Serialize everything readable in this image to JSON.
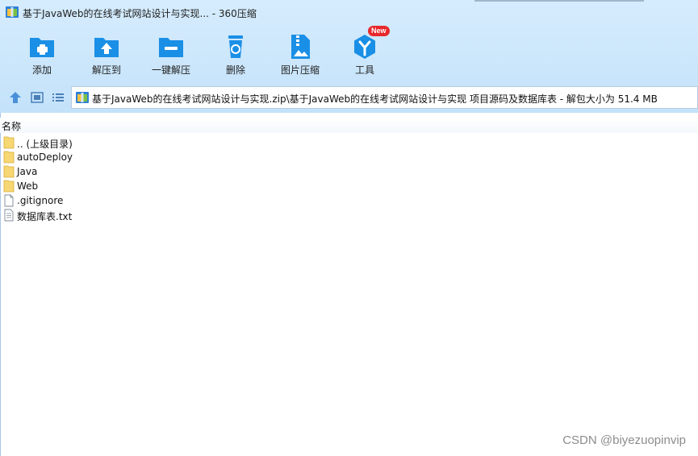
{
  "window": {
    "title": "基于JavaWeb的在线考试网站设计与实现... - 360压缩",
    "title_icon": "archive-icon"
  },
  "toolbar": {
    "items": [
      {
        "label": "添加",
        "icon": "add-folder-icon"
      },
      {
        "label": "解压到",
        "icon": "extract-folder-icon"
      },
      {
        "label": "一键解压",
        "icon": "one-click-extract-icon"
      },
      {
        "label": "删除",
        "icon": "trash-icon"
      },
      {
        "label": "图片压缩",
        "icon": "image-compress-icon"
      },
      {
        "label": "工具",
        "icon": "tools-icon",
        "badge": "New"
      }
    ]
  },
  "navigation": {
    "up_icon": "up-arrow-icon",
    "thumbnail_view_icon": "thumbnail-view-icon",
    "list_view_icon": "list-view-icon",
    "address": "基于JavaWeb的在线考试网站设计与实现.zip\\基于JavaWeb的在线考试网站设计与实现 项目源码及数据库表 - 解包大小为 51.4 MB"
  },
  "file_list": {
    "column_header": "名称",
    "items": [
      {
        "name": ".. (上级目录)",
        "type": "folder"
      },
      {
        "name": "autoDeploy",
        "type": "folder"
      },
      {
        "name": "Java",
        "type": "folder"
      },
      {
        "name": "Web",
        "type": "folder"
      },
      {
        "name": ".gitignore",
        "type": "file"
      },
      {
        "name": "数据库表.txt",
        "type": "text-file"
      }
    ]
  },
  "watermark": "CSDN @biyezuopinvip",
  "colors": {
    "header_bg": "#cbe6fb",
    "icon_blue": "#1a8fe6",
    "badge_red": "#e8282b"
  }
}
